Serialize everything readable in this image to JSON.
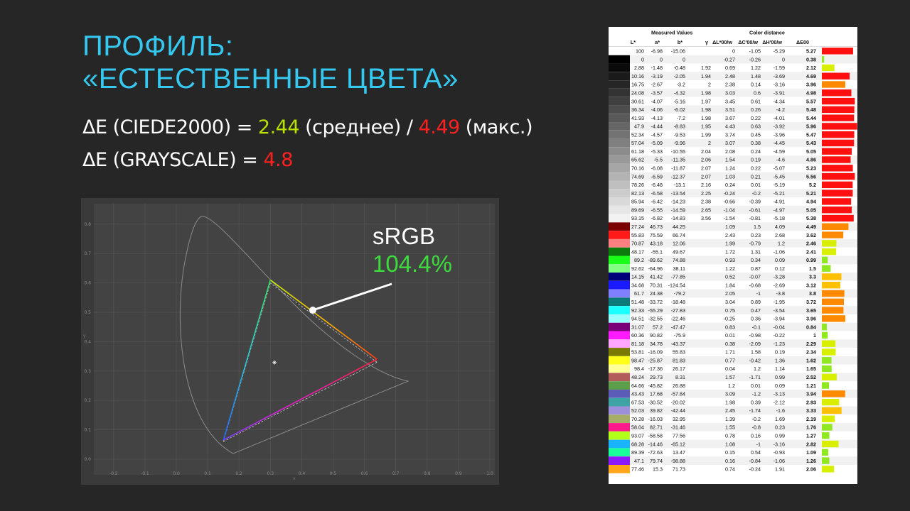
{
  "title": {
    "line1": "ПРОФИЛЬ:",
    "line2": "«ЕСТЕСТВЕННЫЕ ЦВЕТА»"
  },
  "metrics": {
    "line1": {
      "prefix": "ΔE (CIEDE2000) = ",
      "avg": "2.44",
      "avg_label": " (среднее) / ",
      "max": "4.49",
      "max_label": " (макс.)"
    },
    "line2": {
      "prefix": "ΔE (GRAYSCALE) = ",
      "value": "4.8"
    }
  },
  "gamut": {
    "label": "sRGB",
    "value": "104.4%",
    "x_ticks": [
      "-0.2",
      "-0.1",
      "0.0",
      "0.1",
      "0.2",
      "0.3",
      "0.4",
      "0.5",
      "0.6",
      "0.7",
      "0.8",
      "0.9",
      "1.0"
    ],
    "y_ticks": [
      "0.0",
      "0.1",
      "0.2",
      "0.3",
      "0.4",
      "0.5",
      "0.6",
      "0.7",
      "0.8"
    ],
    "x_axis_label": "x",
    "y_axis_label": "y",
    "measured": {
      "red": [
        0.64,
        0.34
      ],
      "green": [
        0.3,
        0.61
      ],
      "blue": [
        0.15,
        0.065
      ]
    },
    "reference": {
      "red": [
        0.64,
        0.33
      ],
      "green": [
        0.3,
        0.6
      ],
      "blue": [
        0.15,
        0.06
      ]
    },
    "white_point": [
      0.313,
      0.329
    ],
    "colors": {
      "accent_green": "#3ddc3d",
      "label_white": "#ffffff"
    }
  },
  "table": {
    "group_measured": "Measured Values",
    "group_distance": "Color distance",
    "headers": [
      "L*",
      "a*",
      "b*",
      "γ",
      "ΔL*00/w",
      "ΔC'00/w",
      "ΔH'00/w",
      "ΔE00"
    ],
    "max_bar_value": 6.0,
    "rows": [
      {
        "swatch": "#ffffff",
        "L": "100",
        "a": "-6.98",
        "b": "-15.06",
        "g": "",
        "dL": "0",
        "dC": "-1.05",
        "dH": "-5.29",
        "dE": "5.27"
      },
      {
        "swatch": "#000000",
        "L": "0",
        "a": "0",
        "b": "0",
        "g": "",
        "dL": "-0.27",
        "dC": "-0.26",
        "dH": "0",
        "dE": "0.38"
      },
      {
        "swatch": "#0b0b0b",
        "L": "2.88",
        "a": "-1.48",
        "b": "-0.48",
        "g": "1.92",
        "dL": "0.69",
        "dC": "1.22",
        "dH": "-1.59",
        "dE": "2.12"
      },
      {
        "swatch": "#1a1a1a",
        "L": "10.16",
        "a": "-3.19",
        "b": "-2.05",
        "g": "1.94",
        "dL": "2.48",
        "dC": "1.48",
        "dH": "-3.69",
        "dE": "4.69"
      },
      {
        "swatch": "#262626",
        "L": "16.75",
        "a": "-2.67",
        "b": "-3.2",
        "g": "2",
        "dL": "2.38",
        "dC": "0.14",
        "dH": "-3.16",
        "dE": "3.96"
      },
      {
        "swatch": "#333333",
        "L": "24.08",
        "a": "-3.57",
        "b": "-4.32",
        "g": "1.98",
        "dL": "3.03",
        "dC": "0.6",
        "dH": "-3.91",
        "dE": "4.98"
      },
      {
        "swatch": "#404040",
        "L": "30.61",
        "a": "-4.07",
        "b": "-5.16",
        "g": "1.97",
        "dL": "3.45",
        "dC": "0.61",
        "dH": "-4.34",
        "dE": "5.57"
      },
      {
        "swatch": "#4d4d4d",
        "L": "36.34",
        "a": "-4.06",
        "b": "-6.02",
        "g": "1.98",
        "dL": "3.51",
        "dC": "0.26",
        "dH": "-4.2",
        "dE": "5.48"
      },
      {
        "swatch": "#595959",
        "L": "41.93",
        "a": "-4.13",
        "b": "-7.2",
        "g": "1.98",
        "dL": "3.67",
        "dC": "0.22",
        "dH": "-4.01",
        "dE": "5.44"
      },
      {
        "swatch": "#666666",
        "L": "47.9",
        "a": "-4.44",
        "b": "-8.83",
        "g": "1.95",
        "dL": "4.43",
        "dC": "0.63",
        "dH": "-3.92",
        "dE": "5.96"
      },
      {
        "swatch": "#737373",
        "L": "52.34",
        "a": "-4.57",
        "b": "-9.53",
        "g": "1.99",
        "dL": "3.74",
        "dC": "0.45",
        "dH": "-3.96",
        "dE": "5.47"
      },
      {
        "swatch": "#808080",
        "L": "57.04",
        "a": "-5.09",
        "b": "-9.96",
        "g": "2",
        "dL": "3.07",
        "dC": "0.38",
        "dH": "-4.45",
        "dE": "5.43"
      },
      {
        "swatch": "#8c8c8c",
        "L": "61.18",
        "a": "-5.33",
        "b": "-10.55",
        "g": "2.04",
        "dL": "2.08",
        "dC": "0.24",
        "dH": "-4.59",
        "dE": "5.05"
      },
      {
        "swatch": "#999999",
        "L": "65.62",
        "a": "-5.5",
        "b": "-11.35",
        "g": "2.06",
        "dL": "1.54",
        "dC": "0.19",
        "dH": "-4.6",
        "dE": "4.86"
      },
      {
        "swatch": "#a6a6a6",
        "L": "70.16",
        "a": "-6.08",
        "b": "-11.87",
        "g": "2.07",
        "dL": "1.24",
        "dC": "0.22",
        "dH": "-5.07",
        "dE": "5.23"
      },
      {
        "swatch": "#b3b3b3",
        "L": "74.69",
        "a": "-6.59",
        "b": "-12.37",
        "g": "2.07",
        "dL": "1.03",
        "dC": "0.21",
        "dH": "-5.45",
        "dE": "5.56"
      },
      {
        "swatch": "#bfbfbf",
        "L": "78.26",
        "a": "-6.48",
        "b": "-13.1",
        "g": "2.16",
        "dL": "0.24",
        "dC": "0.01",
        "dH": "-5.19",
        "dE": "5.2"
      },
      {
        "swatch": "#cccccc",
        "L": "82.13",
        "a": "-6.58",
        "b": "-13.54",
        "g": "2.25",
        "dL": "-0.24",
        "dC": "-0.2",
        "dH": "-5.21",
        "dE": "5.21"
      },
      {
        "swatch": "#d9d9d9",
        "L": "85.94",
        "a": "-6.42",
        "b": "-14.23",
        "g": "2.38",
        "dL": "-0.66",
        "dC": "-0.39",
        "dH": "-4.91",
        "dE": "4.94"
      },
      {
        "swatch": "#e6e6e6",
        "L": "89.69",
        "a": "-6.55",
        "b": "-14.59",
        "g": "2.65",
        "dL": "-1.04",
        "dC": "-0.61",
        "dH": "-4.97",
        "dE": "5.05"
      },
      {
        "swatch": "#f2f2f2",
        "L": "93.15",
        "a": "-6.82",
        "b": "-14.83",
        "g": "3.56",
        "dL": "-1.54",
        "dC": "-0.81",
        "dH": "-5.18",
        "dE": "5.38"
      },
      {
        "swatch": "#7a0000",
        "L": "27.24",
        "a": "46.73",
        "b": "44.25",
        "g": "",
        "dL": "1.09",
        "dC": "1.5",
        "dH": "4.09",
        "dE": "4.49"
      },
      {
        "swatch": "#ff1a1a",
        "L": "55.83",
        "a": "75.59",
        "b": "66.74",
        "g": "",
        "dL": "2.43",
        "dC": "0.23",
        "dH": "2.68",
        "dE": "3.62"
      },
      {
        "swatch": "#ff8080",
        "L": "70.87",
        "a": "43.18",
        "b": "12.06",
        "g": "",
        "dL": "1.99",
        "dC": "-0.79",
        "dH": "1.2",
        "dE": "2.46"
      },
      {
        "swatch": "#0d7a0d",
        "L": "48.17",
        "a": "-55.1",
        "b": "49.67",
        "g": "",
        "dL": "1.72",
        "dC": "1.31",
        "dH": "-1.06",
        "dE": "2.41"
      },
      {
        "swatch": "#1aff1a",
        "L": "89.2",
        "a": "-89.62",
        "b": "74.88",
        "g": "",
        "dL": "0.93",
        "dC": "0.34",
        "dH": "0.09",
        "dE": "0.99"
      },
      {
        "swatch": "#80ff80",
        "L": "92.62",
        "a": "-64.96",
        "b": "38.11",
        "g": "",
        "dL": "1.22",
        "dC": "0.87",
        "dH": "0.12",
        "dE": "1.5"
      },
      {
        "swatch": "#00007a",
        "L": "14.15",
        "a": "41.42",
        "b": "-77.85",
        "g": "",
        "dL": "0.52",
        "dC": "-0.07",
        "dH": "-3.28",
        "dE": "3.3"
      },
      {
        "swatch": "#1a1aff",
        "L": "34.68",
        "a": "70.31",
        "b": "-124.54",
        "g": "",
        "dL": "1.84",
        "dC": "-0.68",
        "dH": "-2.69",
        "dE": "3.12"
      },
      {
        "swatch": "#8080ff",
        "L": "61.7",
        "a": "24.38",
        "b": "-79.2",
        "g": "",
        "dL": "2.05",
        "dC": "-1",
        "dH": "-3.8",
        "dE": "3.8"
      },
      {
        "swatch": "#0d7a7a",
        "L": "51.48",
        "a": "-33.72",
        "b": "-18.48",
        "g": "",
        "dL": "3.04",
        "dC": "0.89",
        "dH": "-1.95",
        "dE": "3.72"
      },
      {
        "swatch": "#1affff",
        "L": "92.33",
        "a": "-55.29",
        "b": "-27.83",
        "g": "",
        "dL": "0.75",
        "dC": "0.47",
        "dH": "-3.54",
        "dE": "3.65"
      },
      {
        "swatch": "#99ffff",
        "L": "94.51",
        "a": "-32.55",
        "b": "-22.46",
        "g": "",
        "dL": "-0.25",
        "dC": "0.36",
        "dH": "-3.94",
        "dE": "3.96"
      },
      {
        "swatch": "#7a007a",
        "L": "31.07",
        "a": "57.2",
        "b": "-47.47",
        "g": "",
        "dL": "0.83",
        "dC": "-0.1",
        "dH": "-0.04",
        "dE": "0.84"
      },
      {
        "swatch": "#ff1aff",
        "L": "60.36",
        "a": "90.82",
        "b": "-75.9",
        "g": "",
        "dL": "0.01",
        "dC": "-0.98",
        "dH": "-0.22",
        "dE": "1"
      },
      {
        "swatch": "#ffa6ff",
        "L": "81.18",
        "a": "34.78",
        "b": "-43.37",
        "g": "",
        "dL": "0.38",
        "dC": "-2.09",
        "dH": "-1.23",
        "dE": "2.29"
      },
      {
        "swatch": "#7a7a00",
        "L": "53.81",
        "a": "-16.09",
        "b": "55.83",
        "g": "",
        "dL": "1.71",
        "dC": "1.58",
        "dH": "0.19",
        "dE": "2.34"
      },
      {
        "swatch": "#ffff1a",
        "L": "98.47",
        "a": "-25.87",
        "b": "81.83",
        "g": "",
        "dL": "0.77",
        "dC": "-0.42",
        "dH": "1.36",
        "dE": "1.62"
      },
      {
        "swatch": "#ffff99",
        "L": "98.4",
        "a": "-17.36",
        "b": "26.17",
        "g": "",
        "dL": "0.04",
        "dC": "1.2",
        "dH": "1.14",
        "dE": "1.65"
      },
      {
        "swatch": "#b35c5c",
        "L": "48.24",
        "a": "29.73",
        "b": "8.31",
        "g": "",
        "dL": "1.57",
        "dC": "-1.71",
        "dH": "0.99",
        "dE": "2.52"
      },
      {
        "swatch": "#5c9e4a",
        "L": "64.66",
        "a": "-45.82",
        "b": "26.88",
        "g": "",
        "dL": "1.2",
        "dC": "0.01",
        "dH": "0.09",
        "dE": "1.21"
      },
      {
        "swatch": "#5c5cb8",
        "L": "43.43",
        "a": "17.68",
        "b": "-57.84",
        "g": "",
        "dL": "3.09",
        "dC": "-1.2",
        "dH": "-3.13",
        "dE": "3.94"
      },
      {
        "swatch": "#3da3a3",
        "L": "67.53",
        "a": "-30.52",
        "b": "-20.02",
        "g": "",
        "dL": "1.98",
        "dC": "0.39",
        "dH": "-2.12",
        "dE": "2.93"
      },
      {
        "swatch": "#9e8fdb",
        "L": "52.03",
        "a": "39.82",
        "b": "-42.44",
        "g": "",
        "dL": "2.45",
        "dC": "-1.74",
        "dH": "-1.6",
        "dE": "3.33"
      },
      {
        "swatch": "#a6ad66",
        "L": "70.28",
        "a": "-16.03",
        "b": "32.95",
        "g": "",
        "dL": "1.39",
        "dC": "-0.2",
        "dH": "1.69",
        "dE": "2.19"
      },
      {
        "swatch": "#ff1a8c",
        "L": "58.04",
        "a": "82.71",
        "b": "-31.46",
        "g": "",
        "dL": "1.55",
        "dC": "-0.8",
        "dH": "0.23",
        "dE": "1.76"
      },
      {
        "swatch": "#b3ff1a",
        "L": "93.07",
        "a": "-58.58",
        "b": "77.56",
        "g": "",
        "dL": "0.78",
        "dC": "0.16",
        "dH": "0.99",
        "dE": "1.27"
      },
      {
        "swatch": "#1ab3ff",
        "L": "68.28",
        "a": "-14.46",
        "b": "-65.12",
        "g": "",
        "dL": "1.08",
        "dC": "-1",
        "dH": "-3.16",
        "dE": "2.82"
      },
      {
        "swatch": "#1aff99",
        "L": "89.39",
        "a": "-72.63",
        "b": "13.47",
        "g": "",
        "dL": "0.15",
        "dC": "0.54",
        "dH": "-0.93",
        "dE": "1.09"
      },
      {
        "swatch": "#8c1aff",
        "L": "47.1",
        "a": "79.74",
        "b": "-98.88",
        "g": "",
        "dL": "0.16",
        "dC": "-0.84",
        "dH": "-1.06",
        "dE": "1.26"
      },
      {
        "swatch": "#ffa61a",
        "L": "77.46",
        "a": "15.3",
        "b": "71.73",
        "g": "",
        "dL": "0.74",
        "dC": "-0.24",
        "dH": "1.91",
        "dE": "2.06"
      }
    ]
  }
}
